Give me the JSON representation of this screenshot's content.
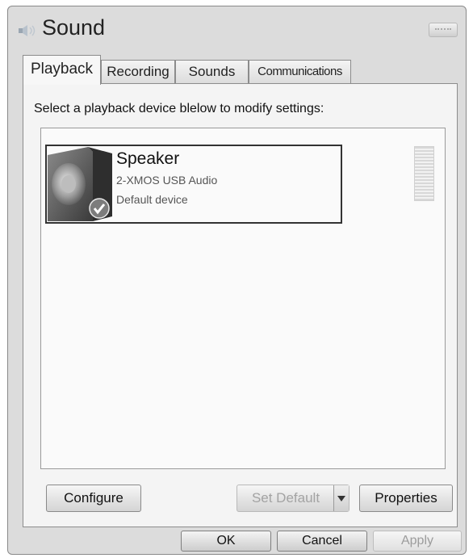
{
  "window": {
    "title": "Sound",
    "icon": "speaker-icon"
  },
  "tabs": [
    {
      "label": "Playback",
      "active": true
    },
    {
      "label": "Recording",
      "active": false
    },
    {
      "label": "Sounds",
      "active": false
    },
    {
      "label": "Communications",
      "active": false
    }
  ],
  "playback": {
    "instruction": "Select a playback device blelow to modify settings:",
    "devices": [
      {
        "name": "Speaker",
        "driver": "2-XMOS USB Audio",
        "status": "Default device",
        "icon": "speaker-device-icon",
        "default_badge": "check-icon",
        "selected": true
      }
    ]
  },
  "buttons": {
    "configure": "Configure",
    "set_default": "Set Default",
    "properties": "Properties"
  },
  "footer": {
    "ok": "OK",
    "cancel": "Cancel",
    "apply": "Apply"
  }
}
